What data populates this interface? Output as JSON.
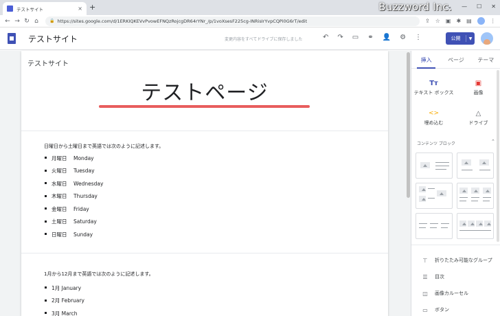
{
  "browser": {
    "tab_title": "テストサイト",
    "tab_close": "×",
    "new_tab": "+",
    "url": "https://sites.google.com/d/1ERKIQKEVvPvowEFNQzRojcgDR64rYNr_/p/1voXsesF225cg-INRisIrYvpCQPi0G6rT/edit",
    "brand_text": "Buzzword Inc.",
    "icons": [
      "back-icon",
      "forward-icon",
      "reload-icon",
      "home-icon"
    ]
  },
  "appbar": {
    "site_title": "テストサイト",
    "save_note": "変更内容をすべてドライブに保存しました",
    "publish_label": "公開"
  },
  "page": {
    "site_name": "テストサイト",
    "heading": "テストページ",
    "section1_intro": "日曜日から土曜日まで英語では次のように記述します。",
    "days": [
      {
        "jp": "月曜日",
        "en": "Monday"
      },
      {
        "jp": "火曜日",
        "en": "Tuesday"
      },
      {
        "jp": "水曜日",
        "en": "Wednesday"
      },
      {
        "jp": "木曜日",
        "en": "Thursday"
      },
      {
        "jp": "金曜日",
        "en": "Friday"
      },
      {
        "jp": "土曜日",
        "en": "Saturday"
      },
      {
        "jp": "日曜日",
        "en": "Sunday"
      }
    ],
    "section2_intro": "1月から12月まで英語では次のように記述します。",
    "months": [
      {
        "jp": "1月",
        "en": "January"
      },
      {
        "jp": "2月",
        "en": "February"
      },
      {
        "jp": "3月",
        "en": "March"
      }
    ]
  },
  "panel": {
    "tabs": [
      "挿入",
      "ページ",
      "テーマ"
    ],
    "insert": [
      {
        "label": "テキスト ボックス",
        "icon": "text-box-icon"
      },
      {
        "label": "画像",
        "icon": "image-icon"
      },
      {
        "label": "埋め込む",
        "icon": "embed-icon"
      },
      {
        "label": "ドライブ",
        "icon": "drive-icon"
      }
    ],
    "blocks_header": "コンテンツ ブロック",
    "items": [
      {
        "label": "折りたたみ可能なグループ",
        "icon": "collapsible-group-icon"
      },
      {
        "label": "目次",
        "icon": "toc-icon"
      },
      {
        "label": "画像カルーセル",
        "icon": "carousel-icon"
      },
      {
        "label": "ボタン",
        "icon": "button-icon"
      }
    ]
  },
  "colors": {
    "accent": "#3f51b5",
    "underline": "#e85d5d"
  }
}
